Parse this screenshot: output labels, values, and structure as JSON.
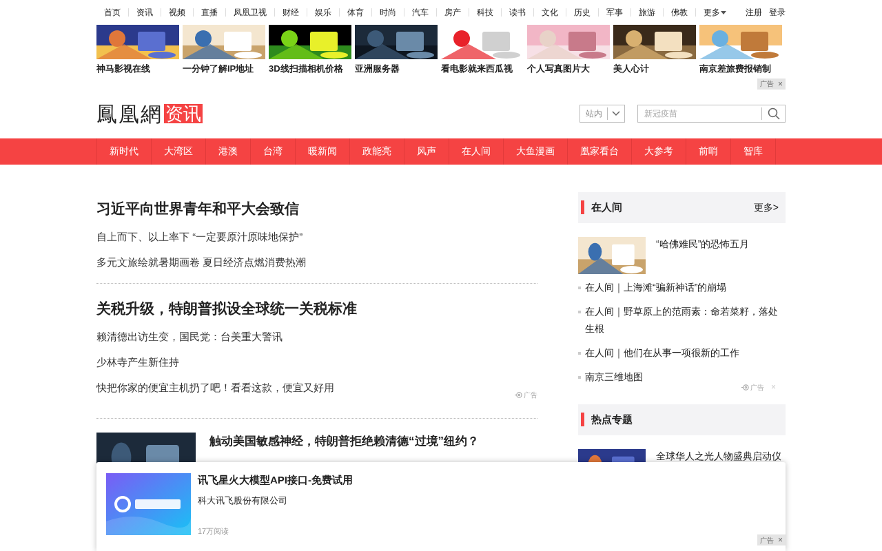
{
  "top_nav": {
    "links": [
      "首页",
      "资讯",
      "视频",
      "直播",
      "凤凰卫视",
      "财经",
      "娱乐",
      "体育",
      "时尚",
      "汽车",
      "房产",
      "科技",
      "读书",
      "文化",
      "历史",
      "军事",
      "旅游",
      "佛教"
    ],
    "more": "更多",
    "account": [
      "注册",
      "登录"
    ]
  },
  "ad_tiles": [
    "神马影视在线",
    "一分钟了解IP地址",
    "3D线扫描相机价格",
    "亚洲服务器",
    "看电影就来西瓜视",
    "个人写真图片大",
    "美人心计",
    "南京差旅费报销制"
  ],
  "ad_tag": {
    "label": "广告",
    "close": "×"
  },
  "logo": {
    "text": "鳳凰網",
    "channel": "资讯"
  },
  "search": {
    "scope": "站内",
    "placeholder": "新冠疫苗"
  },
  "channels": [
    "新时代",
    "大湾区",
    "港澳",
    "台湾",
    "暖新闻",
    "政能亮",
    "风声",
    "在人间",
    "大鱼漫画",
    "凰家看台",
    "大参考",
    "前哨",
    "智库"
  ],
  "news_blocks": [
    {
      "headline": "习近平向世界青年和平大会致信",
      "items": [
        {
          "kind": "link",
          "text": "自上而下、以上率下 “一定要原汁原味地保护”"
        },
        {
          "kind": "link",
          "text": "多元文旅绘就暑期画卷 夏日经济点燃消费热潮"
        }
      ]
    },
    {
      "headline": "关税升级，特朗普拟设全球统一关税标准",
      "items": [
        {
          "kind": "link",
          "text": "赖清德出访生变，国民党：台美重大警讯"
        },
        {
          "kind": "link",
          "text": "少林寺产生新住持"
        },
        {
          "kind": "ad",
          "text": "快把你家的便宜主机扔了吧！看看这款，便宜又好用",
          "tag": "广告"
        }
      ]
    }
  ],
  "featured": {
    "headline": "触动美国敏感神经，特朗普拒绝赖清德“过境”纽约？"
  },
  "sidebar": [
    {
      "title": "在人间",
      "more": "更多>",
      "lead": "“哈佛难民”的恐怖五月",
      "items": [
        {
          "kind": "link",
          "text": "在人间｜上海滩“骗新神话”的崩塌"
        },
        {
          "kind": "link",
          "text": "在人间｜野草原上的范雨素：命若菜籽，落处生根"
        },
        {
          "kind": "link",
          "text": "在人间｜他们在从事一项很新的工作"
        },
        {
          "kind": "ad",
          "text": "南京三维地图",
          "tag": "广告",
          "close": "×"
        }
      ]
    },
    {
      "title": "热点专题",
      "lead": "全球华人之光人物盛典启动仪"
    }
  ],
  "bottom_ad": {
    "title": "讯飞星火大模型API接口-免费试用",
    "company": "科大讯飞股份有限公司",
    "reads": "17万阅读",
    "tag": "广告",
    "close": "×"
  }
}
